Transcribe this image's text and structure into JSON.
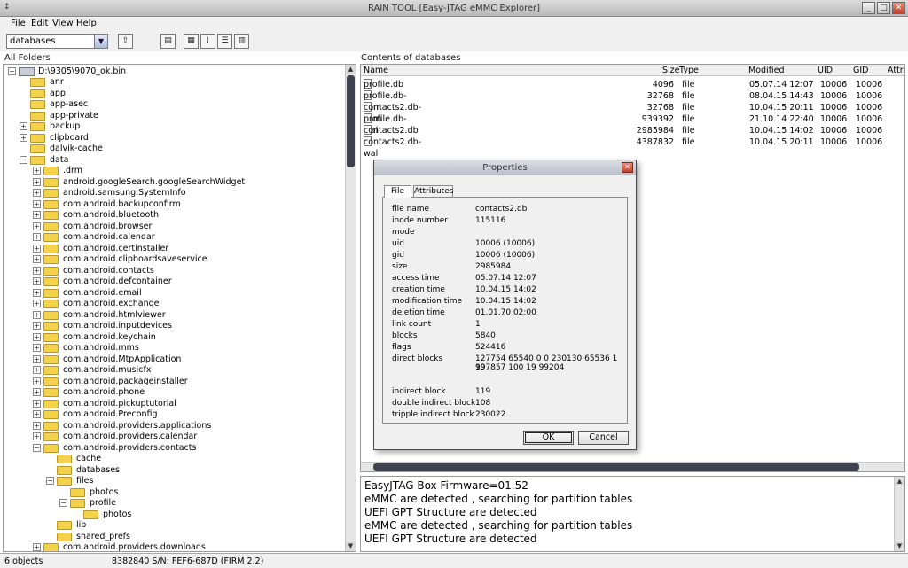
{
  "window": {
    "title": "RAIN TOOL [Easy-JTAG eMMC Explorer]",
    "app_icon": "↕",
    "min": "_",
    "max": "□",
    "close": "✕"
  },
  "menu": [
    "File",
    "Edit",
    "View",
    "Help"
  ],
  "toolbar": {
    "path_value": "databases"
  },
  "left_header": "All Folders",
  "right_header": "Contents of databases",
  "tree": [
    "D:\\9305\\9070_ok.bin",
    "anr",
    "app",
    "app-asec",
    "app-private",
    "backup",
    "clipboard",
    "dalvik-cache",
    "data",
    ".drm",
    "android.googleSearch.googleSearchWidget",
    "android.samsung.SystemInfo",
    "com.android.backupconfirm",
    "com.android.bluetooth",
    "com.android.browser",
    "com.android.calendar",
    "com.android.certinstaller",
    "com.android.clipboardsaveservice",
    "com.android.contacts",
    "com.android.defcontainer",
    "com.android.email",
    "com.android.exchange",
    "com.android.htmlviewer",
    "com.android.inputdevices",
    "com.android.keychain",
    "com.android.mms",
    "com.android.MtpApplication",
    "com.android.musicfx",
    "com.android.packageinstaller",
    "com.android.phone",
    "com.android.pickuptutorial",
    "com.android.Preconfig",
    "com.android.providers.applications",
    "com.android.providers.calendar",
    "com.android.providers.contacts",
    "cache",
    "databases",
    "files",
    "photos",
    "profile",
    "photos",
    "lib",
    "shared_prefs",
    "com.android.providers.downloads"
  ],
  "columns": {
    "name": "Name",
    "size": "Size",
    "type": "Type",
    "modified": "Modified",
    "uid": "UID",
    "gid": "GID",
    "attr": "Attri"
  },
  "files": [
    {
      "name": "profile.db",
      "size": "4096",
      "type": "file",
      "modified": "05.07.14 12:07",
      "uid": "10006",
      "gid": "10006"
    },
    {
      "name": "profile.db-shm",
      "size": "32768",
      "type": "file",
      "modified": "08.04.15 14:43",
      "uid": "10006",
      "gid": "10006"
    },
    {
      "name": "contacts2.db-shm",
      "size": "32768",
      "type": "file",
      "modified": "10.04.15 20:11",
      "uid": "10006",
      "gid": "10006"
    },
    {
      "name": "profile.db-wal",
      "size": "939392",
      "type": "file",
      "modified": "21.10.14 22:40",
      "uid": "10006",
      "gid": "10006"
    },
    {
      "name": "contacts2.db",
      "size": "2985984",
      "type": "file",
      "modified": "10.04.15 14:02",
      "uid": "10006",
      "gid": "10006"
    },
    {
      "name": "contacts2.db-wal",
      "size": "4387832",
      "type": "file",
      "modified": "10.04.15 20:11",
      "uid": "10006",
      "gid": "10006"
    }
  ],
  "log": [
    "EasyJTAG Box Firmware=01.52",
    "eMMC are detected , searching for partition tables",
    "UEFI GPT Structure are detected",
    "eMMC are detected , searching for partition tables",
    "UEFI GPT Structure are detected"
  ],
  "status": {
    "objects": "6 objects",
    "info": "8382840 S/N: FEF6-687D (FIRM 2.2)"
  },
  "dialog": {
    "title": "Properties",
    "tabs": [
      "File",
      "Attributes"
    ],
    "props": [
      {
        "k": "file name",
        "v": "contacts2.db"
      },
      {
        "k": "inode number",
        "v": "115116"
      },
      {
        "k": "mode",
        "v": ""
      },
      {
        "k": "uid",
        "v": "10006 (10006)"
      },
      {
        "k": "gid",
        "v": "10006 (10006)"
      },
      {
        "k": "size",
        "v": "2985984"
      },
      {
        "k": "access time",
        "v": "05.07.14 12:07"
      },
      {
        "k": "creation time",
        "v": "10.04.15 14:02"
      },
      {
        "k": "modification time",
        "v": "10.04.15 14:02"
      },
      {
        "k": "deletion time",
        "v": "01.01.70 02:00"
      },
      {
        "k": "link count",
        "v": "1"
      },
      {
        "k": "blocks",
        "v": "5840"
      },
      {
        "k": "flags",
        "v": "524416"
      },
      {
        "k": "direct blocks",
        "v": "127754 65540 0 0 230130 65536 1 99"
      },
      {
        "k": "",
        "v": "197857 100 19 99204"
      },
      {
        "k": "indirect block",
        "v": "119"
      },
      {
        "k": "double indirect block",
        "v": "108"
      },
      {
        "k": "tripple indirect block",
        "v": "230022"
      }
    ],
    "ok": "OK",
    "cancel": "Cancel"
  }
}
